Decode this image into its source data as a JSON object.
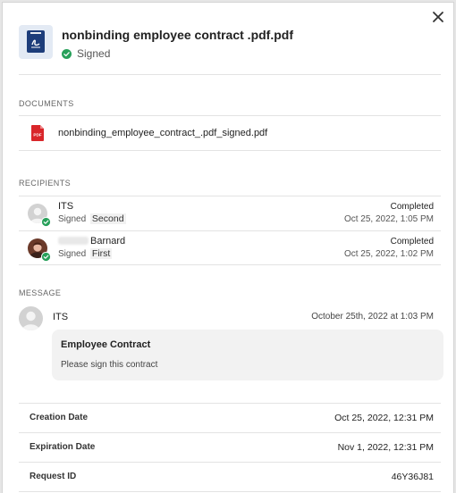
{
  "document": {
    "title": "nonbinding employee contract .pdf.pdf",
    "status": "Signed"
  },
  "sections": {
    "documents": "DOCUMENTS",
    "recipients": "RECIPIENTS",
    "message": "MESSAGE"
  },
  "documents": [
    {
      "filename": "nonbinding_employee_contract_.pdf_signed.pdf",
      "icon": "pdf-file-icon"
    }
  ],
  "recipients": [
    {
      "name": "ITS",
      "role": "Signed",
      "order": "Second",
      "state": "Completed",
      "timestamp": "Oct 25, 2022, 1:05 PM"
    },
    {
      "name": "Barnard",
      "role": "Signed",
      "order": "First",
      "state": "Completed",
      "timestamp": "Oct 25, 2022, 1:02 PM"
    }
  ],
  "message": {
    "from": "ITS",
    "time": "October 25th, 2022 at 1:03 PM",
    "subject": "Employee Contract",
    "body": "Please sign this contract"
  },
  "details": [
    {
      "label": "Creation Date",
      "value": "Oct 25, 2022, 12:31 PM"
    },
    {
      "label": "Expiration Date",
      "value": "Nov 1, 2022, 12:31 PM"
    },
    {
      "label": "Request ID",
      "value": "46Y36J81"
    }
  ],
  "colors": {
    "success": "#27a05a",
    "pdf_red": "#d9262a",
    "doc_blue": "#1d3d7a"
  }
}
